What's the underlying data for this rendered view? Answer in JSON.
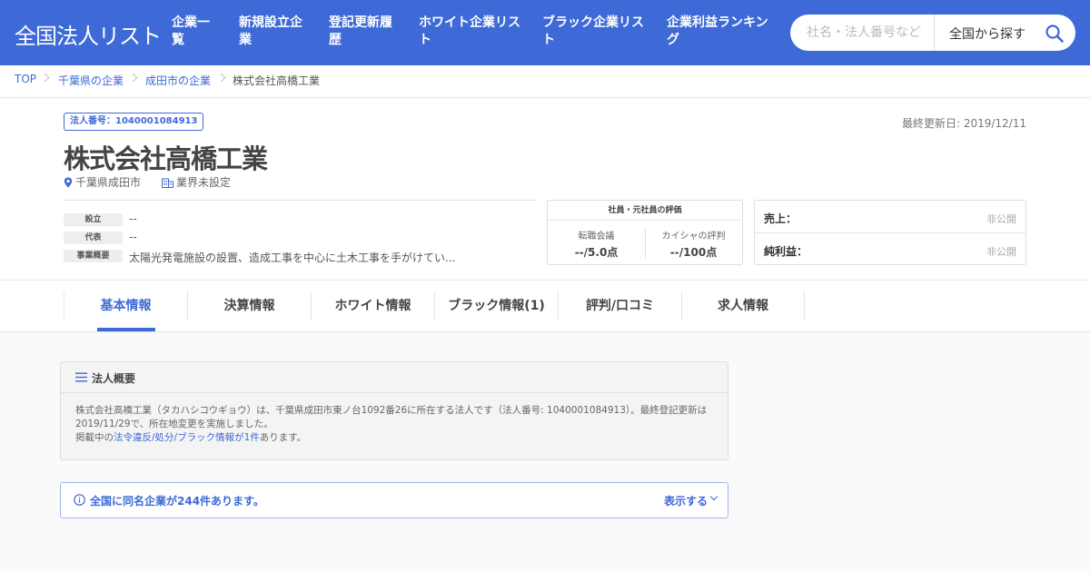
{
  "header": {
    "logo": "全国法人リスト",
    "nav": [
      {
        "line1": "企業一",
        "line2": "覧"
      },
      {
        "line1": "新規設立企",
        "line2": "業"
      },
      {
        "line1": "登記更新履",
        "line2": "歴"
      },
      {
        "line1": "ホワイト企業リス",
        "line2": "ト"
      },
      {
        "line1": "ブラック企業リス",
        "line2": "ト"
      },
      {
        "line1": "企業利益ランキン",
        "line2": "グ"
      }
    ],
    "search": {
      "placeholder": "社名・法人番号など",
      "scope": "全国から探す"
    }
  },
  "breadcrumb": [
    "TOP",
    "千葉県の企業",
    "成田市の企業",
    "株式会社高橋工業"
  ],
  "company": {
    "corporate_number": "法人番号：1040001084913",
    "last_updated": "最終更新日: 2019/12/11",
    "name": "株式会社高橋工業",
    "location": "千葉県成田市",
    "industry": "業界未設定",
    "info": [
      {
        "label": "設立",
        "value": "--"
      },
      {
        "label": "代表",
        "value": "--"
      },
      {
        "label": "事業概要",
        "value": "太陽光発電施設の設置、造成工事を中心に土木工事を手がけてい..."
      }
    ],
    "evaluation": {
      "title": "社員・元社員の評価",
      "sources": [
        {
          "name": "転職会議",
          "score": "--/5.0点"
        },
        {
          "name": "カイシャの評判",
          "score": "--/100点"
        }
      ]
    },
    "financials": [
      {
        "label": "売上：",
        "value": "非公開"
      },
      {
        "label": "純利益：",
        "value": "非公開"
      }
    ]
  },
  "tabs": [
    "基本情報",
    "決算情報",
    "ホワイト情報",
    "ブラック情報(1)",
    "評判/口コミ",
    "求人情報"
  ],
  "overview": {
    "title": "法人概要",
    "text_line": "株式会社高橋工業（タカハシコウギョウ）は、千葉県成田市東ノ台1092番26に所在する法人です（法人番号: 1040001084913）。最終登記更新は2019/11/29で、所在地変更を実施しました。",
    "notice_prefix": "掲載中の",
    "notice_link": "法令違反/処分/ブラック情報が1件",
    "notice_suffix": "あります。"
  },
  "same_name": {
    "text": "全国に同名企業が244件あります。",
    "toggle": "表示する"
  },
  "colors": {
    "brand": "#3d6ad6",
    "muted": "#aaaaaa"
  }
}
